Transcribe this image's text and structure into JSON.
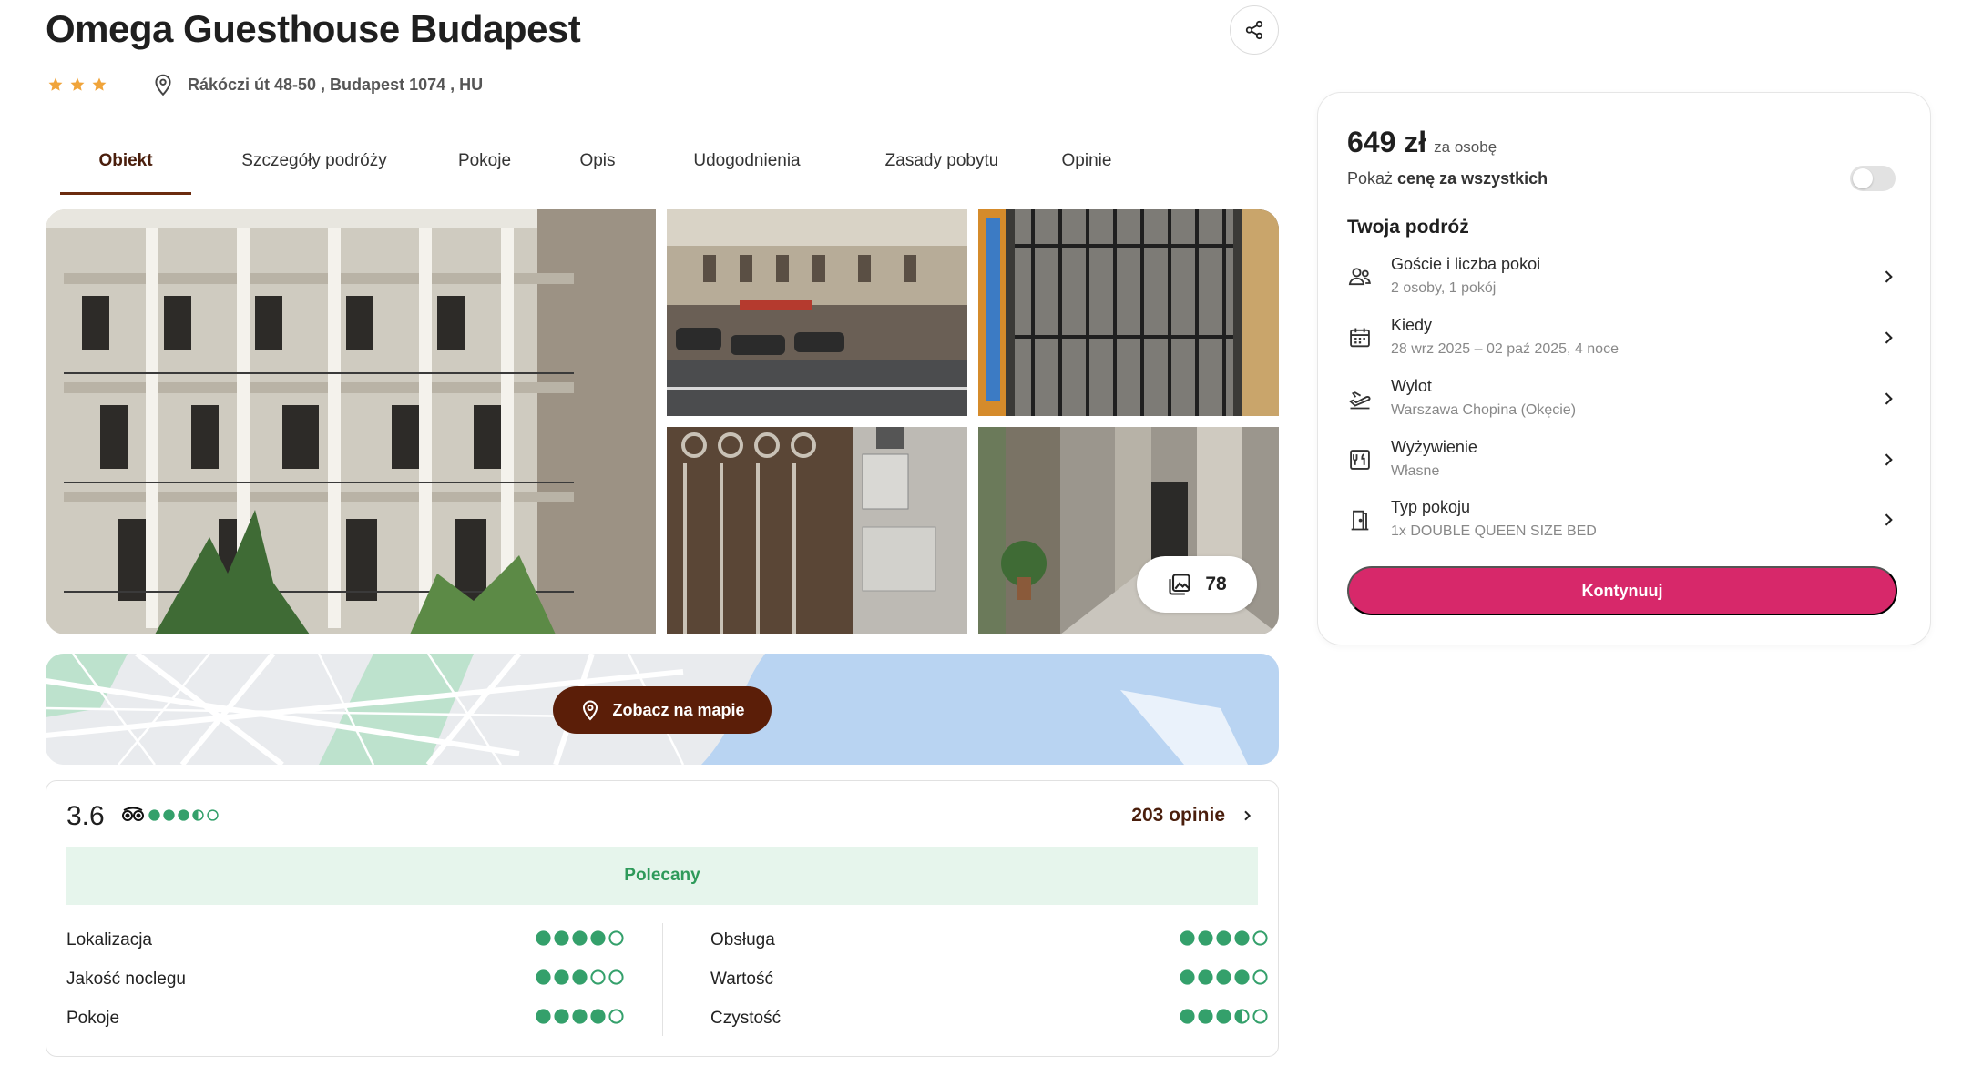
{
  "hotel": {
    "name": "Omega Guesthouse Budapest",
    "stars": 3,
    "address": "Rákóczi út 48-50 , Budapest 1074 , HU",
    "colors": {
      "star": "#f0a43a",
      "brand": "#5b1e08"
    }
  },
  "tabs": [
    {
      "label": "Obiekt",
      "active": true
    },
    {
      "label": "Szczegóły podróży",
      "active": false
    },
    {
      "label": "Pokoje",
      "active": false
    },
    {
      "label": "Opis",
      "active": false
    },
    {
      "label": "Udogodnienia",
      "active": false
    },
    {
      "label": "Zasady pobytu",
      "active": false
    },
    {
      "label": "Opinie",
      "active": false
    }
  ],
  "gallery": {
    "photo_count": "78"
  },
  "map": {
    "button_label": "Zobacz na mapie"
  },
  "reviews": {
    "score": "3.6",
    "score_bubbles": 3.5,
    "count_label": "203 opinie",
    "badge": "Polecany",
    "categories_left": [
      {
        "label": "Lokalizacja",
        "bubbles": 4
      },
      {
        "label": "Jakość noclegu",
        "bubbles": 3
      },
      {
        "label": "Pokoje",
        "bubbles": 4
      }
    ],
    "categories_right": [
      {
        "label": "Obsługa",
        "bubbles": 4
      },
      {
        "label": "Wartość",
        "bubbles": 4
      },
      {
        "label": "Czystość",
        "bubbles": 3.5
      }
    ],
    "colors": {
      "bubble": "#34a06b",
      "badge_bg": "#e6f5ec"
    }
  },
  "booking": {
    "price": "649 zł",
    "price_unit": "za osobę",
    "toggle_prefix": "Pokaż",
    "toggle_bold": "cenę za wszystkich",
    "toggle_on": false,
    "trip_heading": "Twoja podróż",
    "rows": [
      {
        "icon": "guests-icon",
        "label": "Goście i liczba pokoi",
        "value": "2 osoby, 1 pokój"
      },
      {
        "icon": "calendar-icon",
        "label": "Kiedy",
        "value": "28 wrz 2025 – 02 paź 2025, 4 noce"
      },
      {
        "icon": "plane-departure-icon",
        "label": "Wylot",
        "value": "Warszawa Chopina (Okęcie)"
      },
      {
        "icon": "meal-icon",
        "label": "Wyżywienie",
        "value": "Własne"
      },
      {
        "icon": "door-icon",
        "label": "Typ pokoju",
        "value": "1x DOUBLE QUEEN SIZE BED"
      }
    ],
    "cta_label": "Kontynuuj",
    "colors": {
      "cta": "#d7286a"
    }
  }
}
